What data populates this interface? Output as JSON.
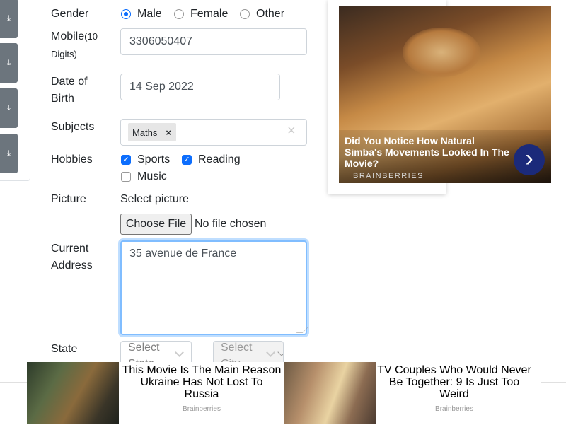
{
  "form": {
    "gender": {
      "label": "Gender",
      "options": [
        "Male",
        "Female",
        "Other"
      ],
      "selected": "Male"
    },
    "mobile": {
      "label": "Mobile",
      "hint": "(10",
      "hint2": "Digits)",
      "value": "3306050407"
    },
    "dob": {
      "label_line1": "Date of",
      "label_line2": "Birth",
      "value": "14 Sep 2022"
    },
    "subjects": {
      "label": "Subjects",
      "tags": [
        "Maths"
      ],
      "tag_remove": "×",
      "clear": "×"
    },
    "hobbies": {
      "label": "Hobbies",
      "sports": "Sports",
      "reading": "Reading",
      "music": "Music",
      "checked": {
        "sports": true,
        "reading": true,
        "music": false
      }
    },
    "picture": {
      "label": "Picture",
      "select_label": "Select picture",
      "button": "Choose File",
      "status": "No file chosen"
    },
    "address": {
      "label_line1": "Current",
      "label_line2": "Address",
      "value": "35 avenue de France"
    },
    "state_city": {
      "label": "State",
      "state_placeholder": "Select State",
      "city_placeholder": "Select City"
    }
  },
  "sidebar": {
    "icons": [
      "download-icon",
      "download-icon",
      "download-icon",
      "download-icon"
    ],
    "glyph": "⤓"
  },
  "ad_right": {
    "headline": "Did You Notice How Natural Simba's Movements Looked In The Movie?",
    "source": "BRAINBERRIES",
    "arrow": "›"
  },
  "ad_bottom": [
    {
      "headline": "This Movie Is The Main Reason Ukraine Has Not Lost To Russia",
      "source": "Brainberries"
    },
    {
      "headline": "TV Couples Who Would Never Be Together: 9 Is Just Too Weird",
      "source": "Brainberries"
    }
  ]
}
